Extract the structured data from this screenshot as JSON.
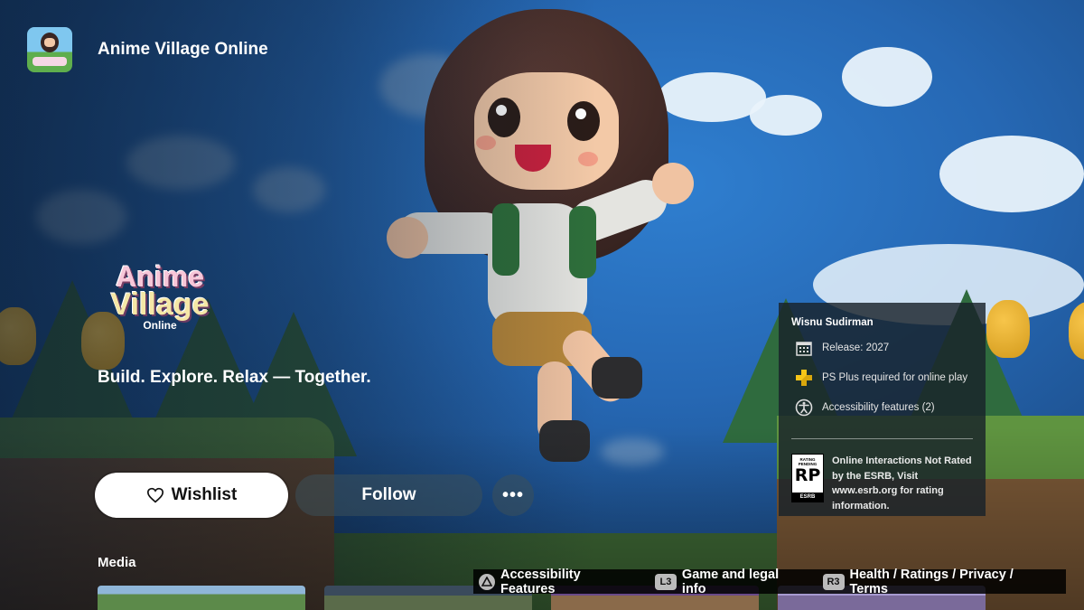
{
  "app": {
    "title": "Anime Village Online",
    "icon": "game-icon"
  },
  "logo": {
    "line1": "Anime",
    "line2": "Village",
    "line3": "Online"
  },
  "tagline": "Build. Explore. Relax — Together.",
  "actions": {
    "wishlist_label": "Wishlist",
    "wishlist_icon": "heart-icon",
    "follow_label": "Follow",
    "more_label": "•••"
  },
  "media": {
    "title": "Media"
  },
  "info_panel": {
    "publisher": "Wisnu Sudirman",
    "items": [
      {
        "icon": "calendar-icon",
        "label": "Release: 2027"
      },
      {
        "icon": "ps-plus-icon",
        "label": "PS Plus required for online play"
      },
      {
        "icon": "accessibility-icon",
        "label": "Accessibility features (2)"
      }
    ],
    "rating": {
      "badge_top": "RATING PENDING",
      "badge_code": "RP",
      "badge_bottom": "ESRB",
      "text": "Online Interactions Not Rated by the ESRB, Visit www.esrb.org for rating information."
    }
  },
  "bottom_bar": {
    "items": [
      {
        "key": "△",
        "label": "Accessibility Features"
      },
      {
        "key": "L3",
        "label": "Game and legal info"
      },
      {
        "key": "R3",
        "label": "Health / Ratings / Privacy / Terms"
      }
    ]
  },
  "colors": {
    "ps_plus": "#f5c518",
    "panel_bg": "#18222a"
  }
}
